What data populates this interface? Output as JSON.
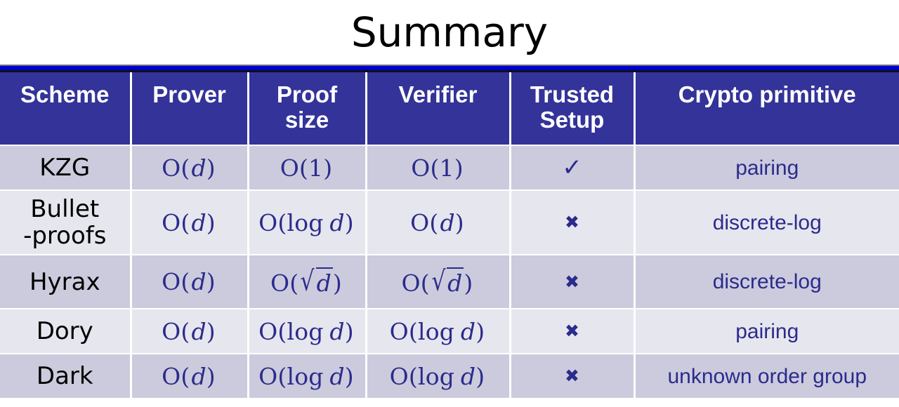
{
  "slide": {
    "title": "Summary",
    "accent_rule_color": "#0000CC",
    "header_bg_color": "#333399",
    "row_shade_color": "#CBCBDD",
    "row_light_color": "#E6E6EE",
    "math_text_color": "#2B2B8C"
  },
  "table": {
    "headers": [
      "Scheme",
      "Prover",
      "Proof\nsize",
      "Verifier",
      "Trusted\nSetup",
      "Crypto primitive"
    ],
    "rows": [
      {
        "scheme": "KZG",
        "prover": "O(d)",
        "proof_size": "O(1)",
        "verifier": "O(1)",
        "trusted_setup": "✓",
        "trusted_setup_name": "check-icon",
        "crypto_primitive": "pairing"
      },
      {
        "scheme": "Bullet\n-proofs",
        "prover": "O(d)",
        "proof_size": "O(log d)",
        "verifier": "O(d)",
        "trusted_setup": "✖",
        "trusted_setup_name": "cross-icon",
        "crypto_primitive": "discrete-log"
      },
      {
        "scheme": "Hyrax",
        "prover": "O(d)",
        "proof_size": "O(√d)",
        "verifier": "O(√d)",
        "trusted_setup": "✖",
        "trusted_setup_name": "cross-icon",
        "crypto_primitive": "discrete-log"
      },
      {
        "scheme": "Dory",
        "prover": "O(d)",
        "proof_size": "O(log d)",
        "verifier": "O(log d)",
        "trusted_setup": "✖",
        "trusted_setup_name": "cross-icon",
        "crypto_primitive": "pairing"
      },
      {
        "scheme": "Dark",
        "prover": "O(d)",
        "proof_size": "O(log d)",
        "verifier": "O(log d)",
        "trusted_setup": "✖",
        "trusted_setup_name": "cross-icon",
        "crypto_primitive": "unknown order group"
      }
    ]
  }
}
